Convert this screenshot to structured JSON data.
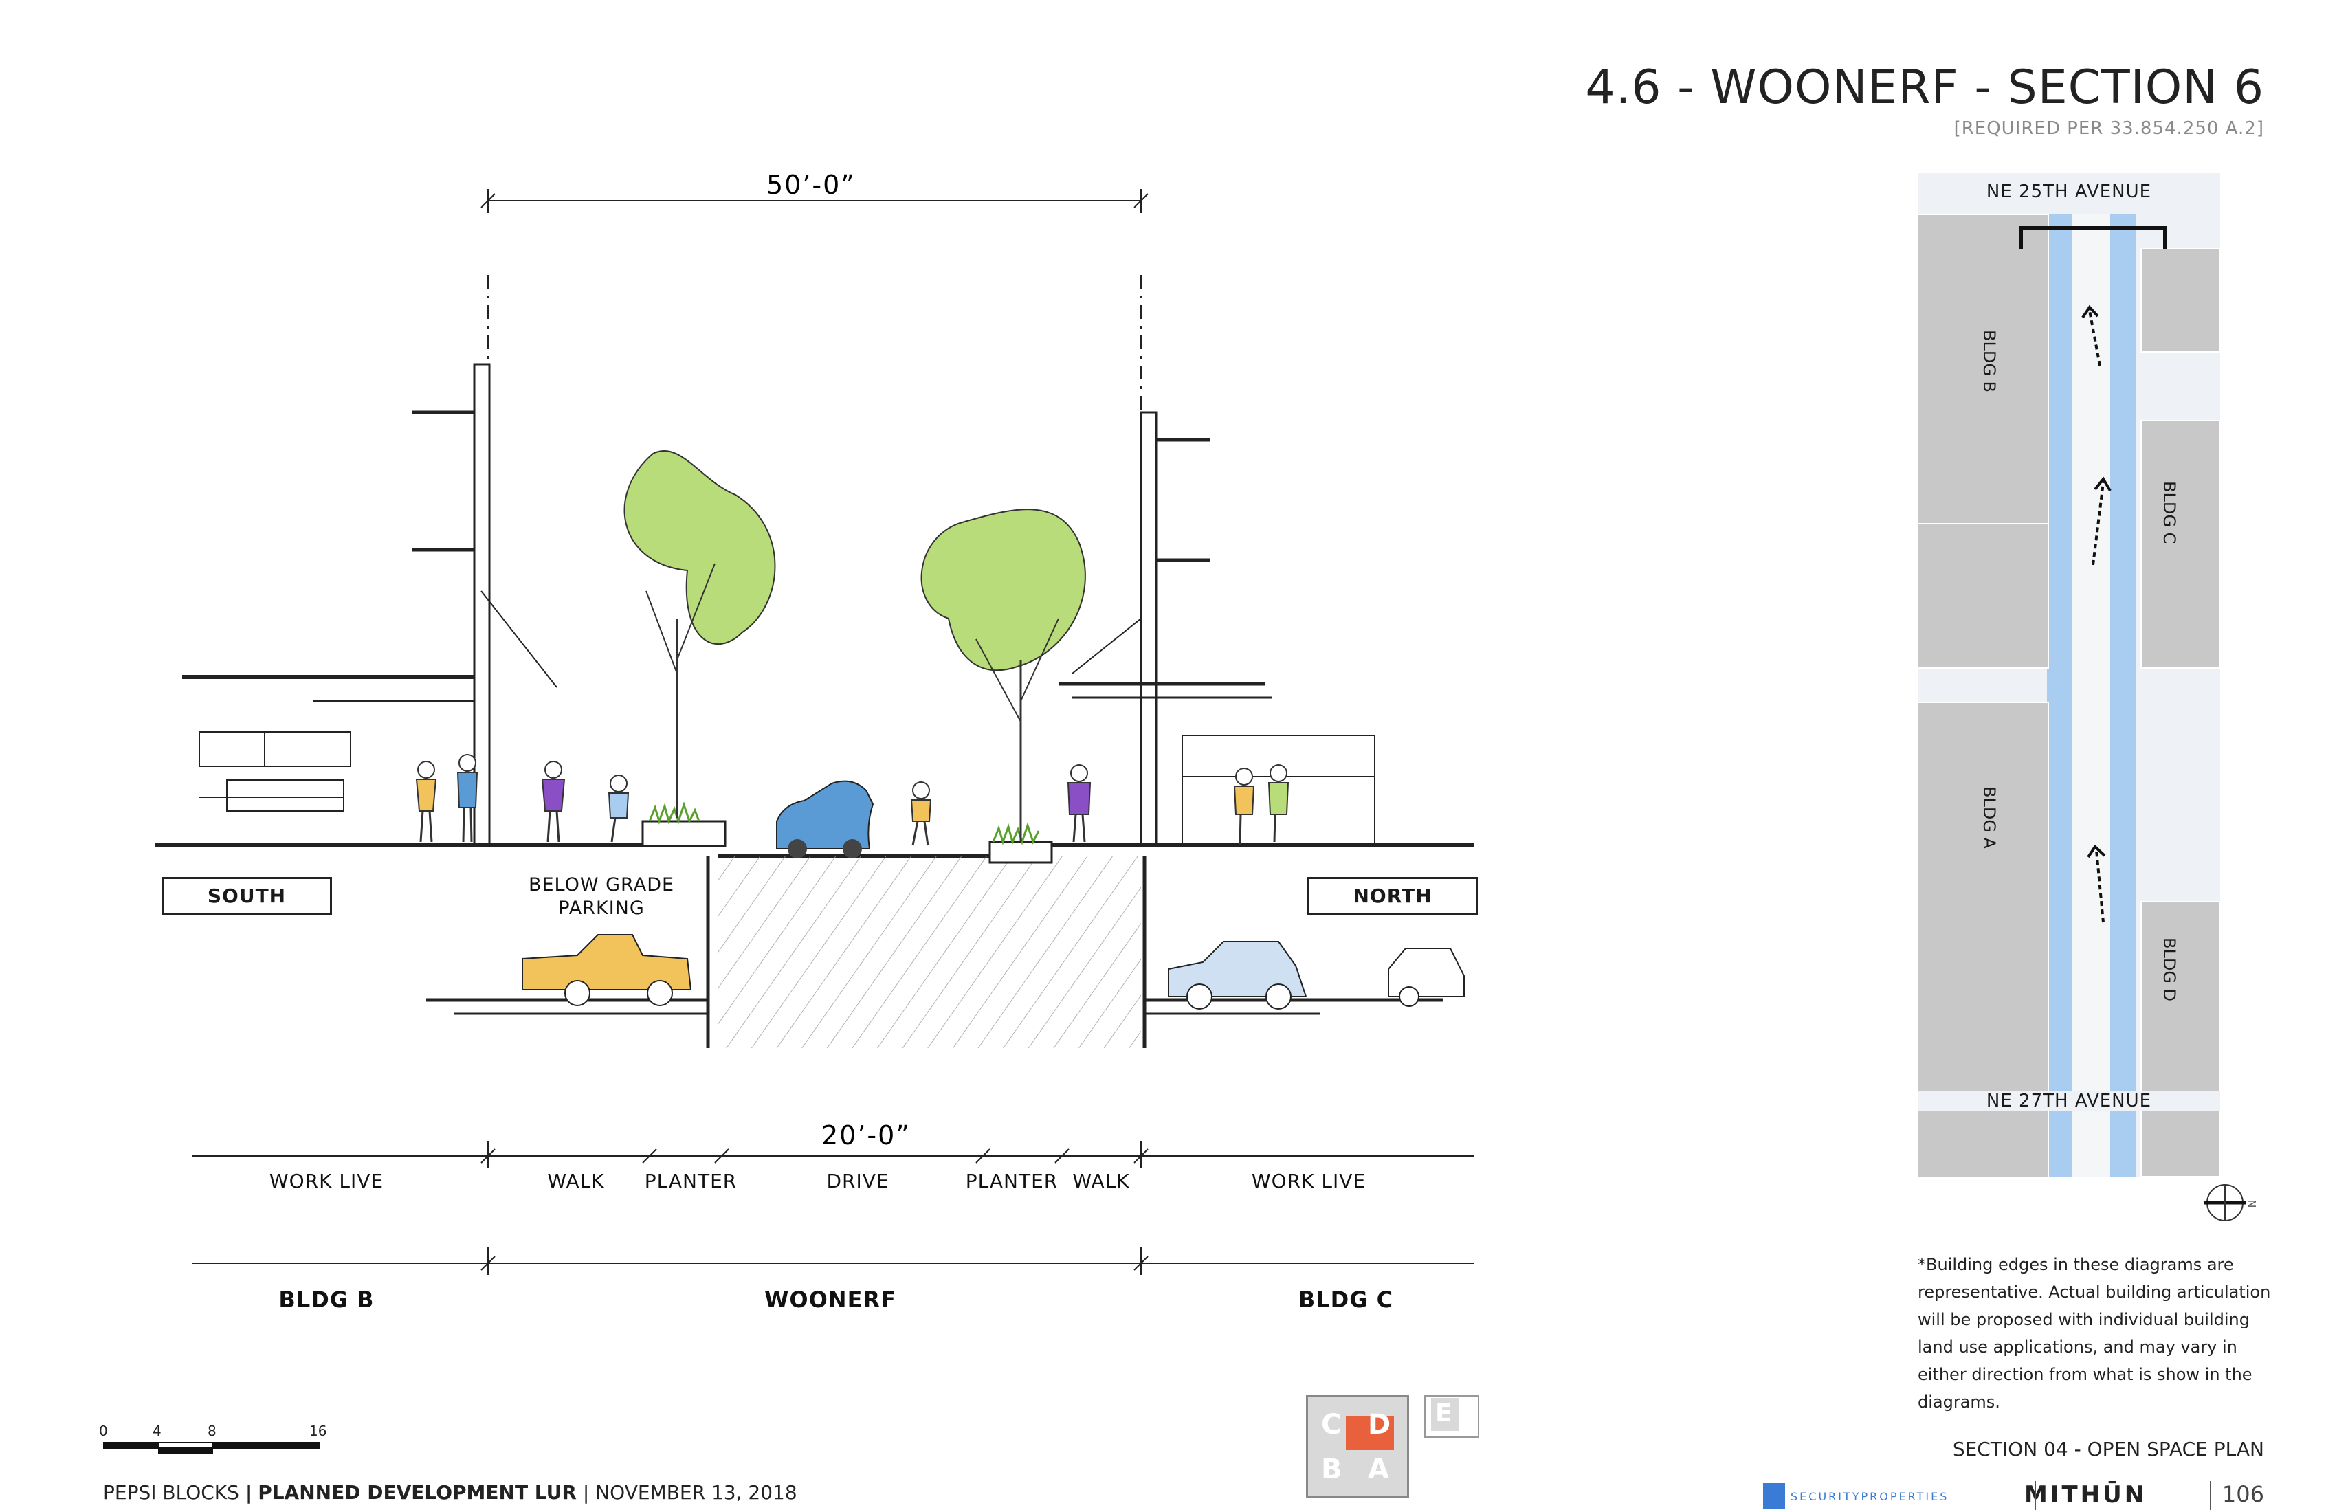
{
  "header": {
    "title": "4.6 - WOONERF - SECTION 6",
    "subtitle": "[REQUIRED PER 33.854.250 A.2]"
  },
  "section": {
    "top_dimension": "50’-0”",
    "bottom_dimension": "20’-0”",
    "south_label": "SOUTH",
    "north_label": "NORTH",
    "parking_label_1": "BELOW GRADE",
    "parking_label_2": "PARKING",
    "zones": [
      "WORK LIVE",
      "WALK",
      "PLANTER",
      "DRIVE",
      "PLANTER",
      "WALK",
      "WORK LIVE"
    ],
    "buildings": [
      "BLDG B",
      "WOONERF",
      "BLDG C"
    ]
  },
  "key_plan": {
    "street_top": "NE 25TH AVENUE",
    "street_bottom": "NE 27TH AVENUE",
    "buildings": [
      "BLDG B",
      "BLDG C",
      "BLDG A",
      "BLDG D"
    ],
    "north_arrow_label": "N"
  },
  "note": "*Building edges in these diagrams are representative.  Actual building articulation will be proposed with individual building land use applications, and may vary in either direction from what is show in the diagrams.",
  "scale_bar": {
    "ticks": [
      "0",
      "4",
      "8",
      "16"
    ]
  },
  "block_key": {
    "letters": [
      "C",
      "D",
      "B",
      "A",
      "E"
    ]
  },
  "footer": {
    "project": "PEPSI BLOCKS",
    "doc": "PLANNED DEVELOPMENT LUR",
    "date": "NOVEMBER 13, 2018",
    "section": "SECTION 04 - OPEN SPACE PLAN",
    "logo1": "SECURITYPROPERTIES",
    "logo2": "MITHŪN",
    "page": "106"
  },
  "colors": {
    "tree": "#b8dc7a",
    "car_blue": "#5b9bd5",
    "car_yellow": "#f2c35a",
    "people_purple": "#8a4fc4",
    "water_blue": "#a9cdf0",
    "building_gray": "#c8c8c8",
    "block_accent": "#e8603c"
  }
}
